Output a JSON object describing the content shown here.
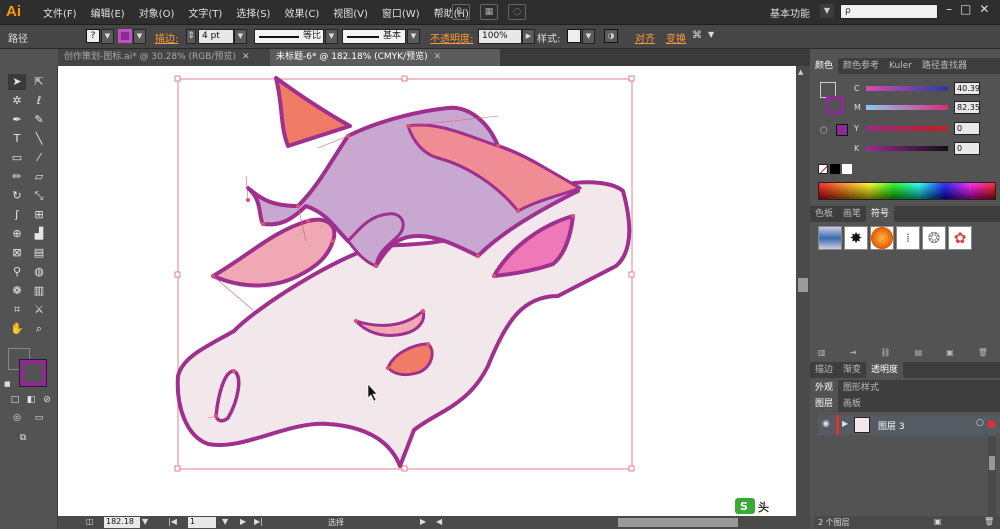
{
  "app": {
    "logo": "Ai"
  },
  "menu": [
    "文件(F)",
    "编辑(E)",
    "对象(O)",
    "文字(T)",
    "选择(S)",
    "效果(C)",
    "视图(V)",
    "窗口(W)",
    "帮助(H)"
  ],
  "workspace": {
    "label": "基本功能",
    "search_placeholder": "ρ"
  },
  "control": {
    "selection": "路径",
    "stroke_label": "描边:",
    "stroke_weight": "4 pt",
    "profile": "等比",
    "brush": "基本",
    "opacity_label": "不透明度:",
    "opacity": "100%",
    "style_label": "样式:",
    "align": "对齐",
    "transform": "变换"
  },
  "tabs": [
    {
      "label": "创作策划-图标.ai* @ 30.28% (RGB/预览)"
    },
    {
      "label": "未标题-6* @ 182.18% (CMYK/预览)"
    }
  ],
  "status": {
    "zoom": "182.18",
    "page": "1",
    "tool": "选择"
  },
  "color_panel": {
    "tabs": [
      "颜色",
      "颜色参考",
      "Kuler",
      "路径查找器"
    ],
    "channels": [
      {
        "label": "C",
        "value": "40.39",
        "color": "#c43fb0"
      },
      {
        "label": "M",
        "value": "82.35",
        "color": "#d62b7a"
      },
      {
        "label": "Y",
        "value": "0",
        "color": "#9a2020"
      },
      {
        "label": "K",
        "value": "0",
        "color": "#6b2a6b"
      }
    ],
    "stroke_color": "#8e2a96"
  },
  "symbols_panel": {
    "tabs": [
      "色板",
      "画笔",
      "符号"
    ]
  },
  "transparency_panel": {
    "tabs": [
      "描边",
      "渐变",
      "透明度"
    ]
  },
  "appearance_panel": {
    "tabs": [
      "外观",
      "图形样式"
    ]
  },
  "layers_panel": {
    "tabs": [
      "图层",
      "画板"
    ],
    "layers": [
      {
        "name": "图层 3"
      }
    ],
    "footer": "2 个图层"
  },
  "artwork": {
    "outline_color": "#a0308e",
    "face_color": "#f2e8ec",
    "horn_color": "#f07c66",
    "mane_color": "#c8a8d0",
    "mane_pink": "#f08c94",
    "ear_inner": "#ee78b8"
  },
  "watermark": {
    "label": "头"
  }
}
